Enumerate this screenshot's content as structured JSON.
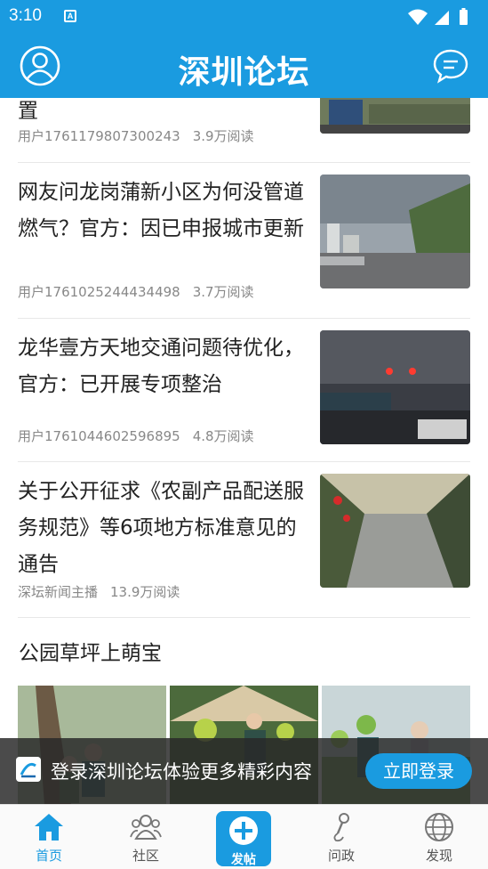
{
  "status_bar": {
    "time": "3:10",
    "notification_icon": "A"
  },
  "header": {
    "title": "深圳论坛",
    "left_icon": "user-avatar-icon",
    "right_icon": "message-bubble-icon"
  },
  "feed": [
    {
      "title": "置",
      "author": "用户1761179807300243",
      "reads": "3.9万阅读"
    },
    {
      "title": "网友问龙岗蒲新小区为何没管道燃气？官方：因已申报城市更新",
      "author": "用户1761025244434498",
      "reads": "3.7万阅读"
    },
    {
      "title": "龙华壹方天地交通问题待优化，官方：已开展专项整治",
      "author": "用户1761044602596895",
      "reads": "4.8万阅读"
    },
    {
      "title": "关于公开征求《农副产品配送服务规范》等6项地方标准意见的通告",
      "author": "深坛新闻主播",
      "reads": "13.9万阅读"
    }
  ],
  "gallery": {
    "title": "公园草坪上萌宝"
  },
  "login_banner": {
    "text": "登录深圳论坛体验更多精彩内容",
    "button": "立即登录"
  },
  "tabs": [
    {
      "label": "首页",
      "icon": "home-icon",
      "active": true
    },
    {
      "label": "社区",
      "icon": "community-icon",
      "active": false
    },
    {
      "label": "发帖",
      "icon": "plus-icon",
      "active": false
    },
    {
      "label": "问政",
      "icon": "microphone-icon",
      "active": false
    },
    {
      "label": "发现",
      "icon": "globe-icon",
      "active": false
    }
  ],
  "colors": {
    "brand": "#1a9be0",
    "meta_text": "#888888"
  }
}
